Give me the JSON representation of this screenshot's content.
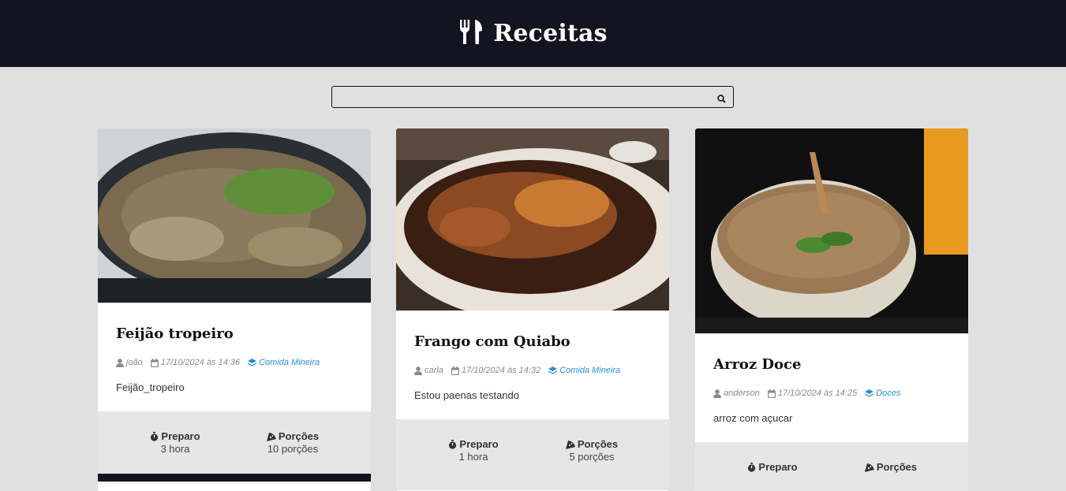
{
  "header": {
    "title": "Receitas",
    "icon": "utensils-icon"
  },
  "search": {
    "placeholder": "",
    "value": ""
  },
  "recipes": [
    {
      "title": "Feijão tropeiro",
      "author": "joão",
      "date": "17/10/2024 às 14:36",
      "category": "Comida Mineira",
      "description": "Feijão_tropeiro",
      "prep_label": "Preparo",
      "prep_value": "3 hora",
      "portions_label": "Porções",
      "portions_value": "10 porções"
    },
    {
      "title": "Frango com Quiabo",
      "author": "carla",
      "date": "17/10/2024 às 14:32",
      "category": "Comida Mineira",
      "description": "Estou paenas testando",
      "prep_label": "Preparo",
      "prep_value": "1 hora",
      "portions_label": "Porções",
      "portions_value": "5 porções"
    },
    {
      "title": "Arroz Doce",
      "author": "anderson",
      "date": "17/10/2024 às 14:25",
      "category": "Doces",
      "description": "arroz com açucar",
      "prep_label": "Preparo",
      "prep_value": "",
      "portions_label": "Porções",
      "portions_value": ""
    }
  ],
  "colors": {
    "header_bg": "#141420",
    "page_bg": "#e0e0e0",
    "category": "#2a8fd4"
  }
}
